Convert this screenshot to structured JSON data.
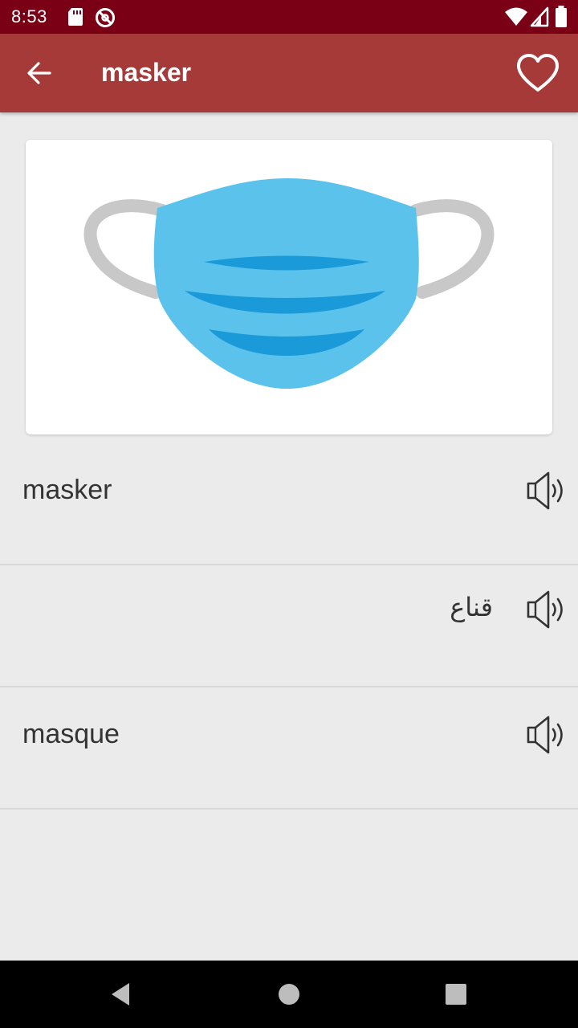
{
  "status_bar": {
    "time": "8:53",
    "icons": [
      "sd-card-icon",
      "do-not-disturb-icon",
      "wifi-icon",
      "signal-icon",
      "battery-icon"
    ]
  },
  "app_bar": {
    "title": "masker",
    "back_icon": "arrow-left-icon",
    "favorite_icon": "heart-outline-icon"
  },
  "image": {
    "subject": "face-mask-icon",
    "colors": {
      "mask": "#5bc2ec",
      "pleat": "#1a9ad9",
      "strap": "#c8c8c8"
    }
  },
  "translations": [
    {
      "text": "masker",
      "direction": "ltr",
      "speaker_icon": "speaker-icon"
    },
    {
      "text": "قناع",
      "direction": "rtl",
      "speaker_icon": "speaker-icon"
    },
    {
      "text": "masque",
      "direction": "ltr",
      "speaker_icon": "speaker-icon"
    }
  ],
  "nav_bar": {
    "buttons": [
      "back-triangle-icon",
      "home-circle-icon",
      "recents-square-icon"
    ]
  },
  "colors": {
    "status_bar": "#790015",
    "app_bar": "#a63a39",
    "background": "#ebebeb",
    "text": "#333333"
  }
}
